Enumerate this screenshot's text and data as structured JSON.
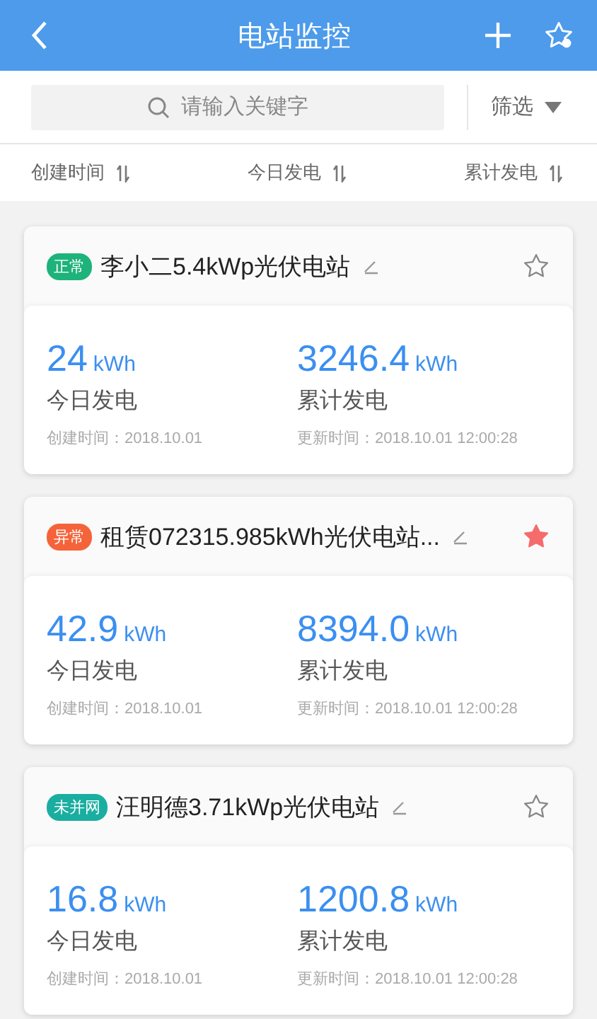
{
  "header": {
    "title": "电站监控"
  },
  "search": {
    "placeholder": "请输入关键字"
  },
  "filter": {
    "label": "筛选"
  },
  "sort_bar": [
    {
      "label": "创建时间"
    },
    {
      "label": "今日发电"
    },
    {
      "label": "累计发电"
    }
  ],
  "stations": [
    {
      "status": "正常",
      "color": "#1db37a",
      "name": "李小二5.4kWp光伏电站",
      "favorite": false,
      "today_value": "24",
      "today_unit": "kWh",
      "today_label": "今日发电",
      "total_value": "3246.4",
      "total_unit": "kWh",
      "total_label": "累计发电",
      "created": "创建时间：2018.10.01",
      "updated": "更新时间：2018.10.01 12:00:28"
    },
    {
      "status": "异常",
      "color": "#f5633a",
      "name": "租赁072315.985kWh光伏电站...",
      "favorite": true,
      "today_value": "42.9",
      "today_unit": "kWh",
      "today_label": "今日发电",
      "total_value": "8394.0",
      "total_unit": "kWh",
      "total_label": "累计发电",
      "created": "创建时间：2018.10.01",
      "updated": "更新时间：2018.10.01 12:00:28"
    },
    {
      "status": "未并网",
      "color": "#1aaea0",
      "name": "汪明德3.71kWp光伏电站",
      "favorite": false,
      "today_value": "16.8",
      "today_unit": "kWh",
      "today_label": "今日发电",
      "total_value": "1200.8",
      "total_unit": "kWh",
      "total_label": "累计发电",
      "created": "创建时间：2018.10.01",
      "updated": "更新时间：2018.10.01 12:00:28"
    }
  ]
}
